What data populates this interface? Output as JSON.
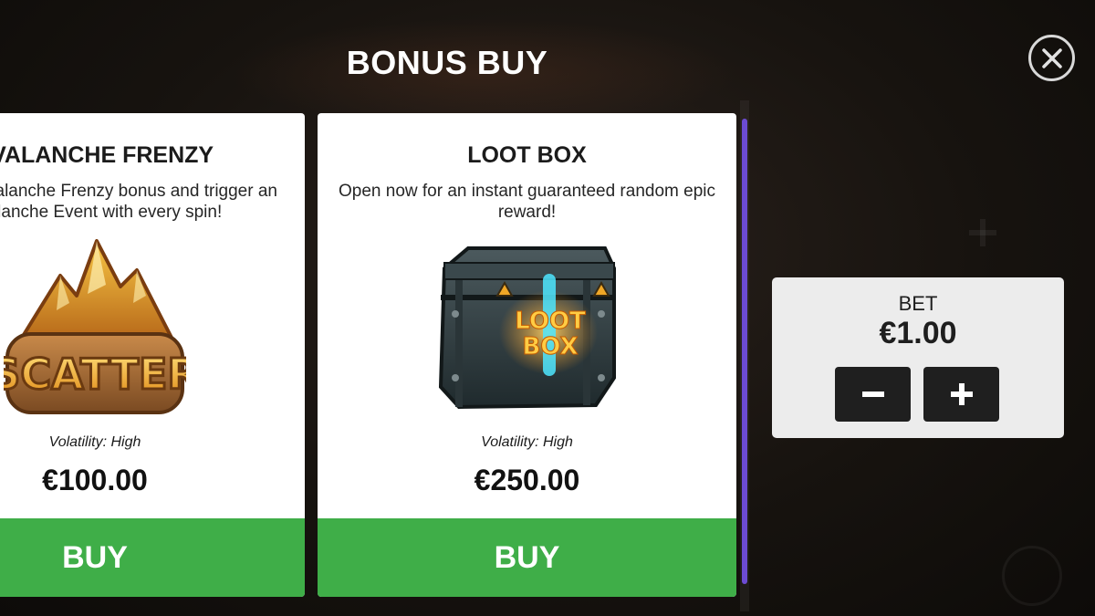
{
  "modal": {
    "title": "BONUS BUY",
    "close_icon": "close-icon"
  },
  "cards": [
    {
      "title": "AVALANCHE FRENZY",
      "description": "Buy the Avalanche Frenzy bonus and trigger an Avalanche Event with every spin!",
      "image": "scatter-mountain-icon",
      "image_text": "SCATTER",
      "volatility": "Volatility: High",
      "price": "€100.00",
      "buy_label": "BUY"
    },
    {
      "title": "LOOT BOX",
      "description": "Open now for an instant guaranteed random epic reward!",
      "image": "loot-box-chest-icon",
      "image_text_line1": "LOOT",
      "image_text_line2": "BOX",
      "volatility": "Volatility: High",
      "price": "€250.00",
      "buy_label": "BUY"
    }
  ],
  "bet": {
    "label": "BET",
    "value": "€1.00",
    "decrease_icon": "minus-icon",
    "increase_icon": "plus-icon"
  },
  "colors": {
    "buy_green": "#3fae48",
    "scrollbar_purple": "#6c4bd3",
    "panel_bg": "#ececec",
    "button_dark": "#1f1f1f"
  }
}
